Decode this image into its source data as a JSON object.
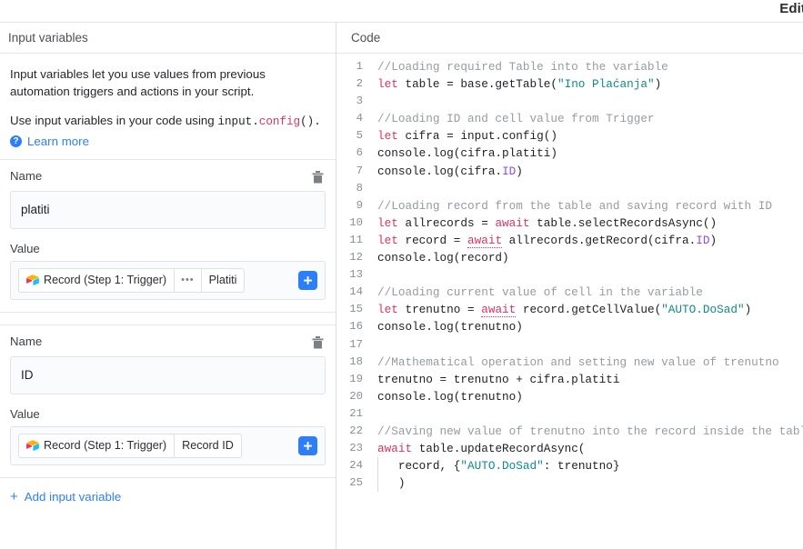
{
  "window": {
    "title": "Edit"
  },
  "left_panel": {
    "header": "Input variables",
    "intro_line_1": "Input variables let you use values from previous automation triggers and actions in your script.",
    "intro_line_2_prefix": "Use input variables in your code using ",
    "intro_code_object": "input.",
    "intro_code_method": "config",
    "intro_code_suffix": "().",
    "help_icon": "question-mark-icon",
    "learn_more_label": "Learn more",
    "add_variable_label": "Add input variable",
    "add_variable_plus": "+",
    "name_label": "Name",
    "value_label": "Value",
    "delete_icon": "trash-icon",
    "add_icon": "plus-icon",
    "variables": [
      {
        "name_value": "platiti",
        "name_placeholder": "Name",
        "token_source": "Record (Step 1: Trigger)",
        "token_separator": "•••",
        "token_field": "Platiti",
        "token_icon": "airtable-logo-icon",
        "has_separator": true
      },
      {
        "name_value": "ID",
        "name_placeholder": "Name",
        "token_source": "Record (Step 1: Trigger)",
        "token_separator": "",
        "token_field": "Record ID",
        "token_icon": "airtable-logo-icon",
        "has_separator": false
      }
    ]
  },
  "right_panel": {
    "header": "Code",
    "colors": {
      "comment": "#969ba2",
      "keyword": "#e0315f",
      "string": "#0f8a8a",
      "property": "#8a4fe0",
      "text": "#1d1f25",
      "gutter": "#8a8f96"
    },
    "code_lines": [
      {
        "n": "1",
        "indent": 0,
        "tokens": [
          {
            "t": "comment",
            "v": "//Loading required Table into the variable"
          }
        ]
      },
      {
        "n": "2",
        "indent": 0,
        "tokens": [
          {
            "t": "keyword",
            "v": "let"
          },
          {
            "t": "plain",
            "v": " table = base.getTable("
          },
          {
            "t": "string",
            "v": "\"Ino Plaćanja\""
          },
          {
            "t": "plain",
            "v": ")"
          }
        ]
      },
      {
        "n": "3",
        "indent": 0,
        "tokens": []
      },
      {
        "n": "4",
        "indent": 0,
        "tokens": [
          {
            "t": "comment",
            "v": "//Loading ID and cell value from Trigger"
          }
        ]
      },
      {
        "n": "5",
        "indent": 0,
        "tokens": [
          {
            "t": "keyword",
            "v": "let"
          },
          {
            "t": "plain",
            "v": " cifra = input.config()"
          }
        ]
      },
      {
        "n": "6",
        "indent": 0,
        "tokens": [
          {
            "t": "plain",
            "v": "console.log(cifra.platiti)"
          }
        ]
      },
      {
        "n": "7",
        "indent": 0,
        "tokens": [
          {
            "t": "plain",
            "v": "console.log(cifra."
          },
          {
            "t": "prop",
            "v": "ID"
          },
          {
            "t": "plain",
            "v": ")"
          }
        ]
      },
      {
        "n": "8",
        "indent": 0,
        "tokens": []
      },
      {
        "n": "9",
        "indent": 0,
        "tokens": [
          {
            "t": "comment",
            "v": "//Loading record from the table and saving record with ID"
          }
        ]
      },
      {
        "n": "10",
        "indent": 0,
        "tokens": [
          {
            "t": "keyword",
            "v": "let"
          },
          {
            "t": "plain",
            "v": " allrecords = "
          },
          {
            "t": "keyword",
            "v": "await"
          },
          {
            "t": "plain",
            "v": " table.selectRecordsAsync()"
          }
        ]
      },
      {
        "n": "11",
        "indent": 0,
        "tokens": [
          {
            "t": "keyword",
            "v": "let"
          },
          {
            "t": "plain",
            "v": " record = "
          },
          {
            "t": "squiggle",
            "v": "await"
          },
          {
            "t": "plain",
            "v": " allrecords.getRecord(cifra."
          },
          {
            "t": "prop",
            "v": "ID"
          },
          {
            "t": "plain",
            "v": ")"
          }
        ]
      },
      {
        "n": "12",
        "indent": 0,
        "tokens": [
          {
            "t": "plain",
            "v": "console.log(record)"
          }
        ]
      },
      {
        "n": "13",
        "indent": 0,
        "tokens": []
      },
      {
        "n": "14",
        "indent": 0,
        "tokens": [
          {
            "t": "comment",
            "v": "//Loading current value of cell in the variable"
          }
        ]
      },
      {
        "n": "15",
        "indent": 0,
        "tokens": [
          {
            "t": "keyword",
            "v": "let"
          },
          {
            "t": "plain",
            "v": " trenutno = "
          },
          {
            "t": "squiggle",
            "v": "await"
          },
          {
            "t": "plain",
            "v": " record.getCellValue("
          },
          {
            "t": "string",
            "v": "\"AUTO.DoSad\""
          },
          {
            "t": "plain",
            "v": ")"
          }
        ]
      },
      {
        "n": "16",
        "indent": 0,
        "tokens": [
          {
            "t": "plain",
            "v": "console.log(trenutno)"
          }
        ]
      },
      {
        "n": "17",
        "indent": 0,
        "tokens": []
      },
      {
        "n": "18",
        "indent": 0,
        "tokens": [
          {
            "t": "comment",
            "v": "//Mathematical operation and setting new value of trenutno"
          }
        ]
      },
      {
        "n": "19",
        "indent": 0,
        "tokens": [
          {
            "t": "plain",
            "v": "trenutno = trenutno + cifra.platiti"
          }
        ]
      },
      {
        "n": "20",
        "indent": 0,
        "tokens": [
          {
            "t": "plain",
            "v": "console.log(trenutno)"
          }
        ]
      },
      {
        "n": "21",
        "indent": 0,
        "tokens": []
      },
      {
        "n": "22",
        "indent": 0,
        "tokens": [
          {
            "t": "comment",
            "v": "//Saving new value of trenutno into the record inside the table"
          }
        ]
      },
      {
        "n": "23",
        "indent": 0,
        "tokens": [
          {
            "t": "keyword",
            "v": "await"
          },
          {
            "t": "plain",
            "v": " table.updateRecordAsync("
          }
        ]
      },
      {
        "n": "24",
        "indent": 1,
        "tokens": [
          {
            "t": "plain",
            "v": "   record, {"
          },
          {
            "t": "string",
            "v": "\"AUTO.DoSad\""
          },
          {
            "t": "plain",
            "v": ": trenutno}"
          }
        ]
      },
      {
        "n": "25",
        "indent": 1,
        "tokens": [
          {
            "t": "plain",
            "v": "   )"
          }
        ]
      }
    ]
  }
}
